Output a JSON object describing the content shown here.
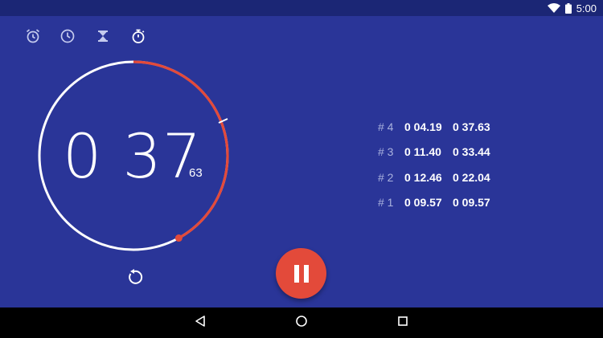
{
  "status_bar": {
    "time": "5:00",
    "icons": [
      "wifi-icon",
      "battery-icon"
    ]
  },
  "tabs": [
    {
      "name": "alarm",
      "icon": "alarm-clock-icon"
    },
    {
      "name": "clock",
      "icon": "clock-icon"
    },
    {
      "name": "timer",
      "icon": "hourglass-icon"
    },
    {
      "name": "stopwatch",
      "icon": "stopwatch-icon",
      "active": true
    }
  ],
  "stopwatch": {
    "time_main": "0 37",
    "hundredths": "63",
    "progress_fraction_current_lap": 0.42,
    "colors": {
      "ring": "#ffffff",
      "progress": "#e34a3a",
      "background": "#2a3598"
    }
  },
  "laps": [
    {
      "num": "# 4",
      "split": "0 04.19",
      "total": "0 37.63"
    },
    {
      "num": "# 3",
      "split": "0 11.40",
      "total": "0 33.44"
    },
    {
      "num": "# 2",
      "split": "0 12.46",
      "total": "0 22.04"
    },
    {
      "num": "# 1",
      "split": "0 09.57",
      "total": "0 09.57"
    }
  ],
  "controls": {
    "primary": "pause-icon",
    "secondary": "reset-icon"
  },
  "nav_bar": [
    "back-icon",
    "home-icon",
    "recents-icon"
  ]
}
